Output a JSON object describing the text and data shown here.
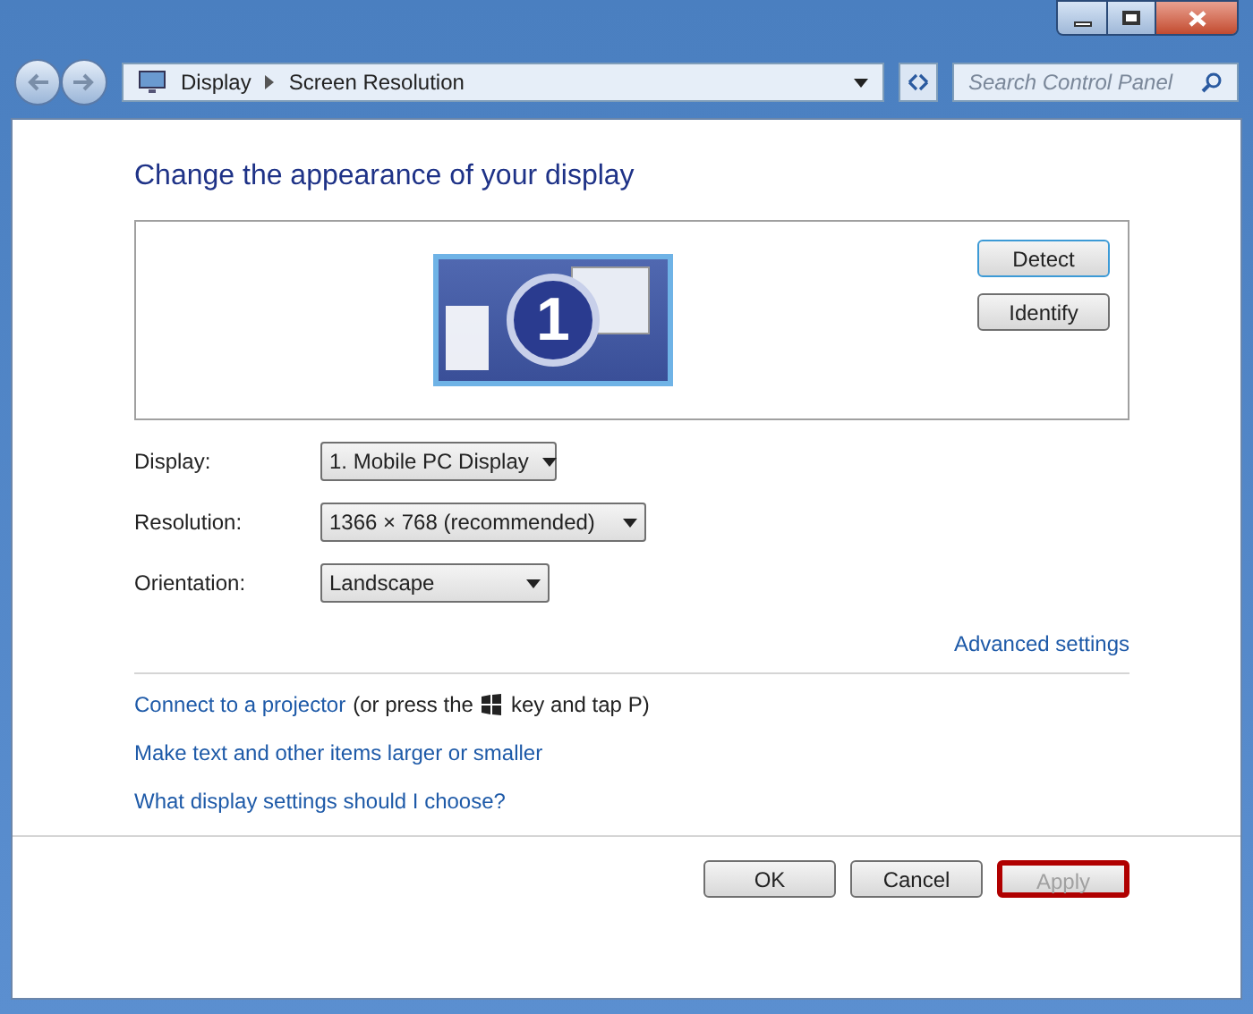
{
  "address_bar": {
    "breadcrumbs": [
      "Display",
      "Screen Resolution"
    ]
  },
  "search": {
    "placeholder": "Search Control Panel"
  },
  "heading": "Change the appearance of your display",
  "monitor": {
    "number": "1"
  },
  "monitor_buttons": [
    "Detect",
    "Identify"
  ],
  "fields": [
    {
      "label": "Display:",
      "value": "1. Mobile PC Display"
    },
    {
      "label": "Resolution:",
      "value": "1366 × 768 (recommended)"
    },
    {
      "label": "Orientation:",
      "value": "Landscape"
    }
  ],
  "advanced_link": "Advanced settings",
  "projector": {
    "link": "Connect to a projector",
    "before_key": "(or press the",
    "after_key": "key and tap P)"
  },
  "links": [
    "Make text and other items larger or smaller",
    "What display settings should I choose?"
  ],
  "buttons": [
    {
      "label": "OK",
      "disabled": false,
      "highlighted": false
    },
    {
      "label": "Cancel",
      "disabled": false,
      "highlighted": false
    },
    {
      "label": "Apply",
      "disabled": true,
      "highlighted": true
    }
  ]
}
